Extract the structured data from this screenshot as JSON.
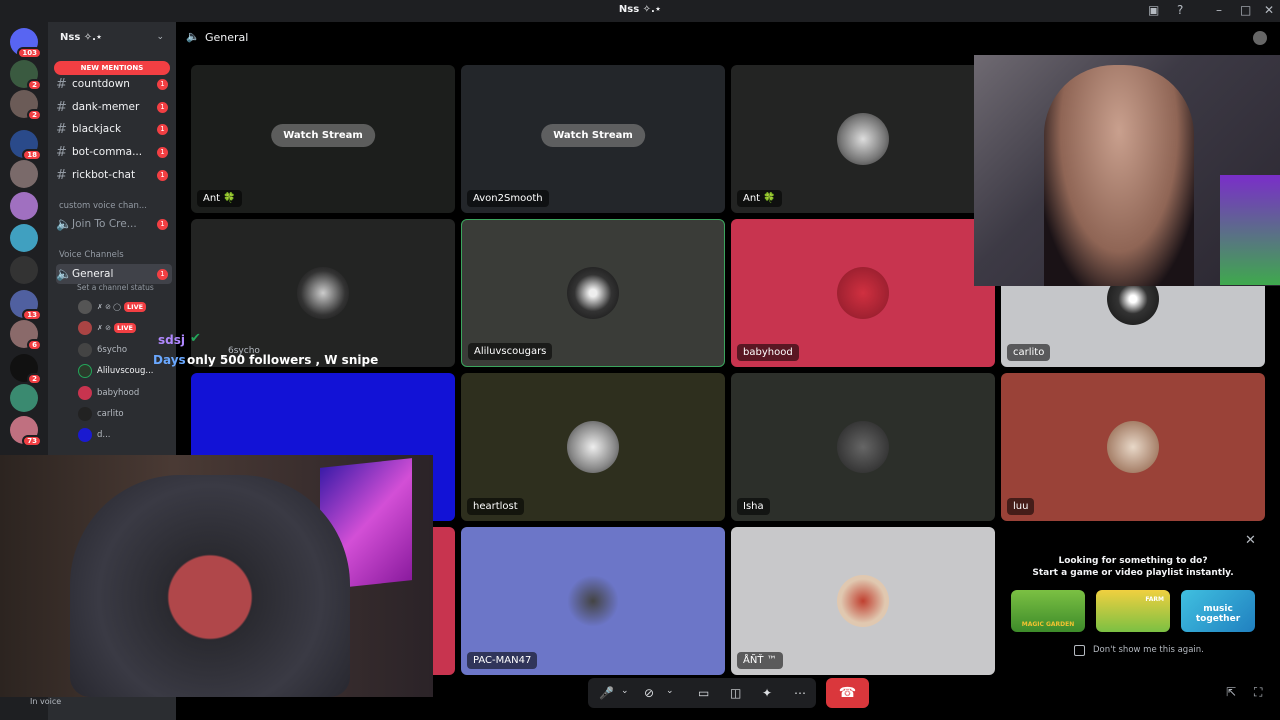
{
  "window": {
    "title": "Nss ✧.⋆"
  },
  "server": {
    "name": "Nss ✧.⋆",
    "new_mentions": "NEW MENTIONS"
  },
  "server_badges": [
    "103",
    "2",
    "2",
    "18",
    "2",
    "13",
    "6",
    "2",
    "73"
  ],
  "text_channels": [
    {
      "name": "countdown",
      "count": "1"
    },
    {
      "name": "dank-memer",
      "count": "1"
    },
    {
      "name": "blackjack",
      "count": "1"
    },
    {
      "name": "bot-comma...",
      "count": "1"
    },
    {
      "name": "rickbot-chat",
      "count": "1"
    }
  ],
  "custom_category": "custom voice chan...",
  "join_to_create": {
    "name": "Join To Cre...",
    "count": "1"
  },
  "voice_category": "Voice Channels",
  "general": {
    "name": "General",
    "count": "1",
    "status": "Set a channel status"
  },
  "voice_users": [
    "",
    "",
    "6sycho",
    "Aliluvscoug...",
    "babyhood",
    "carlito",
    "d..."
  ],
  "live_label": "LIVE",
  "header": {
    "channel": "General"
  },
  "tiles": [
    {
      "name": "Ant 🍀",
      "watch": "Watch Stream"
    },
    {
      "name": "Avon2Smooth",
      "watch": "Watch Stream"
    },
    {
      "name": "Ant 🍀"
    },
    {
      "name": ""
    },
    {
      "name": "Aliluvscougars"
    },
    {
      "name": "babyhood"
    },
    {
      "name": "carlito"
    },
    {
      "name": ""
    },
    {
      "name": "heartlost"
    },
    {
      "name": "Isha"
    },
    {
      "name": "luu"
    },
    {
      "name": "PAC-MAN47"
    },
    {
      "name": "ÅÑŤ ™"
    }
  ],
  "overlay": {
    "sdsj": "sdsj",
    "days": "Days",
    "message": "only 500 followers , W snipe",
    "psycho": "6sycho"
  },
  "activity": {
    "line1": "Looking for something to do?",
    "line2": "Start a game or video playlist instantly.",
    "dont_show": "Don't show me this again.",
    "games": [
      "MAGIC GARDEN",
      "FARM",
      "music together"
    ]
  },
  "user_status": "In voice",
  "colors": {
    "accent": "#5865f2",
    "red": "#da373c",
    "live": "#f23f43"
  }
}
